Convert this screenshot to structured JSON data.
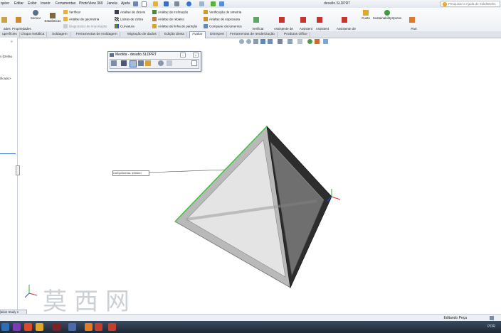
{
  "menu": [
    "quivo",
    "Editar",
    "Exibir",
    "Inserir",
    "Ferramentas",
    "PhotoView 360",
    "Janela",
    "Ajuda"
  ],
  "window_title": "desafio.SLDPRT",
  "help_search_placeholder": "Pesquisar a Ajuda do SolidWorks",
  "ribbon": {
    "left_buttons": [
      {
        "label": "ades\ndo"
      },
      {
        "label": "Propriedades\nde seção"
      },
      {
        "label": "Sensor"
      },
      {
        "label": "Estatísticas"
      }
    ],
    "check_column": [
      "Verificar",
      "Análise de geometria",
      "Diagnóstico de importação"
    ],
    "analysis_column1": [
      "Análise de desvio",
      "Listras de zebra",
      "Curvatura"
    ],
    "analysis_column2": [
      "Análise de inclinação",
      "Análise de rebaixo",
      "Análise de linha de partição"
    ],
    "analysis_column3": [
      "Verificação de simetria",
      "Análise de espessura",
      "Comparar documentos"
    ],
    "verify_button": "Verificar\ndocum...",
    "right_buttons": [
      {
        "label": "Assistente de\nAnálise\nSimulationXpress"
      },
      {
        "label": "Assistent\ne de\nAnális..."
      },
      {
        "label": "Assistent\ne de\nAnális..."
      },
      {
        "label": "Assistente de\nDriveWorksXpress"
      },
      {
        "label": "Custo"
      },
      {
        "label": "SustainabilityXpress"
      },
      {
        "label": "Part\nReviewer"
      }
    ]
  },
  "tabs": [
    "uperfícies",
    "Chapa metálica",
    "Soldagem",
    "Ferramentas de moldagem",
    "Migração de dados",
    "Edição direta",
    "Avaliar",
    "DimXpert",
    "Ferramentas de renderização",
    "Produtos Office"
  ],
  "active_tab": "Avaliar",
  "left_panel": [
    "s (Defau",
    "ificado>"
  ],
  "measure_dialog": {
    "title": "Medida - desafio.SLDPRT"
  },
  "dimension_callout": "Comprimento: 100mm",
  "bottom_tab": "ation Study 1",
  "status": "Editando Peça",
  "tray": "POR"
}
